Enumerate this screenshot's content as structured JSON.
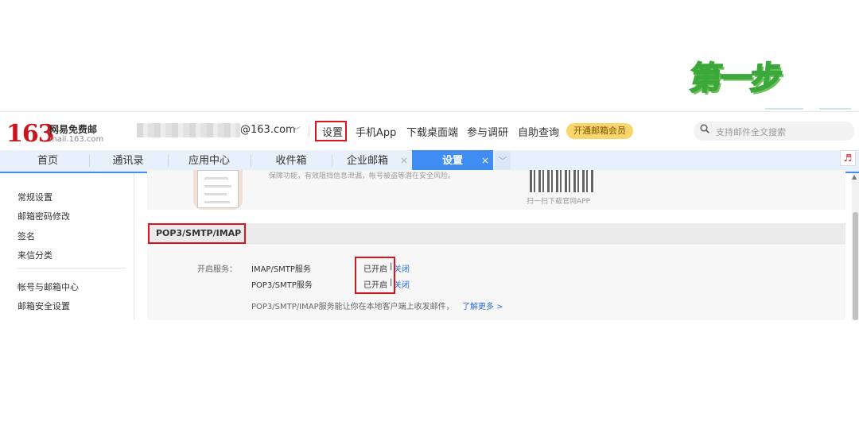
{
  "step_label": "第一步",
  "header": {
    "logo_number": "163",
    "logo_name": "网易免费邮",
    "logo_domain": "mail.163.com",
    "account_domain": "@163.com",
    "links": [
      "设置",
      "手机App",
      "下载桌面端",
      "参与调研",
      "自助查询"
    ],
    "vip_button": "开通邮箱会员",
    "search_placeholder": "支持邮件全文搜索"
  },
  "tabs": [
    "首页",
    "通讯录",
    "应用中心",
    "收件箱",
    "企业邮箱",
    "设置"
  ],
  "sidebar": {
    "group1": [
      "常规设置",
      "邮箱密码修改",
      "签名",
      "来信分类"
    ],
    "group2": [
      "帐号与邮箱中心",
      "邮箱安全设置"
    ]
  },
  "banner": {
    "text": "保障功能，有效阻挡信息泄漏，帐号被盗等潜在安全风险。",
    "qr_caption": "扫一扫下载官网APP"
  },
  "section": {
    "title": "POP3/SMTP/IMAP",
    "service_label": "开启服务：",
    "services": [
      {
        "name": "IMAP/SMTP服务",
        "status": "已开启",
        "sep": "|",
        "action": "关闭"
      },
      {
        "name": "POP3/SMTP服务",
        "status": "已开启",
        "sep": "|",
        "action": "关闭"
      }
    ],
    "note": "POP3/SMTP/IMAP服务能让你在本地客户端上收发邮件，",
    "note_link": "了解更多 >"
  },
  "colors": {
    "accent_blue": "#3f8cf3",
    "highlight_red": "#d9161e",
    "brand_red": "#c8161e",
    "vip_yellow": "#f8d66b"
  }
}
